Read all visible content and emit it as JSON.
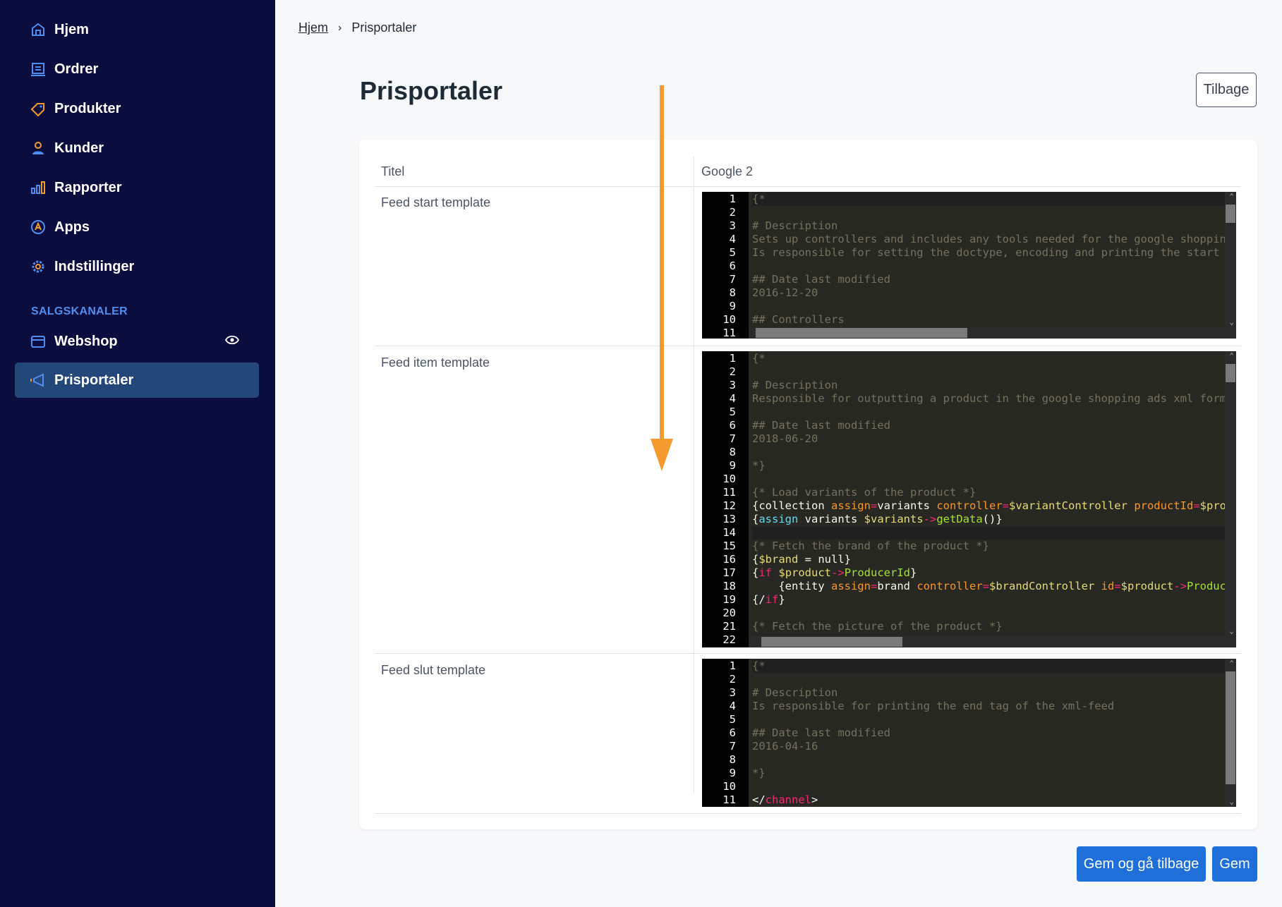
{
  "sidebar": {
    "nav": [
      {
        "label": "Hjem",
        "icon": "home-icon"
      },
      {
        "label": "Ordrer",
        "icon": "orders-icon"
      },
      {
        "label": "Produkter",
        "icon": "tag-icon"
      },
      {
        "label": "Kunder",
        "icon": "user-icon"
      },
      {
        "label": "Rapporter",
        "icon": "bar-chart-icon"
      },
      {
        "label": "Apps",
        "icon": "apps-icon"
      },
      {
        "label": "Indstillinger",
        "icon": "gear-icon"
      }
    ],
    "section_label": "SALGSKANALER",
    "channels": [
      {
        "label": "Webshop",
        "icon": "store-icon"
      },
      {
        "label": "Prisportaler",
        "icon": "megaphone-icon",
        "active": true
      }
    ]
  },
  "breadcrumb": {
    "home": "Hjem",
    "separator": "›",
    "current": "Prisportaler"
  },
  "page": {
    "title": "Prisportaler",
    "back_button": "Tilbage"
  },
  "form": {
    "title_label": "Titel",
    "title_value": "Google 2",
    "feed_start_label": "Feed start template",
    "feed_item_label": "Feed item template",
    "feed_end_label": "Feed slut template"
  },
  "actions": {
    "save_back": "Gem og gå tilbage",
    "save": "Gem"
  },
  "colors": {
    "sidebar_bg": "#0b0d3f",
    "active_item": "#24477a",
    "primary": "#1e6fd9",
    "accent_arrow": "#f59a2e",
    "editor_bg": "#272822"
  }
}
